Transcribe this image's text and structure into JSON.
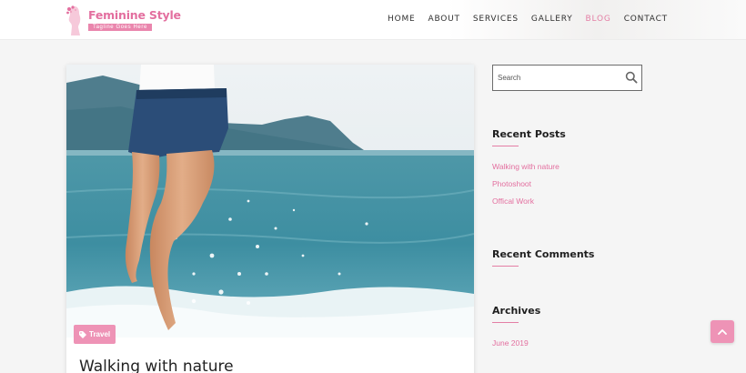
{
  "brand": {
    "title": "Feminine Style",
    "tagline": "Tagline Goes Here"
  },
  "nav": {
    "items": [
      {
        "label": "HOME"
      },
      {
        "label": "ABOUT"
      },
      {
        "label": "SERVICES"
      },
      {
        "label": "GALLERY"
      },
      {
        "label": "BLOG",
        "active": true
      },
      {
        "label": "CONTACT"
      }
    ]
  },
  "post": {
    "image_icon": "beach-photo",
    "tag": "Travel",
    "title": "Walking with nature"
  },
  "sidebar": {
    "search": {
      "placeholder": "Search",
      "value": ""
    },
    "recent_posts": {
      "title": "Recent Posts",
      "items": [
        "Walking with nature",
        "Photoshoot",
        "Offical Work"
      ]
    },
    "recent_comments": {
      "title": "Recent Comments"
    },
    "archives": {
      "title": "Archives",
      "items": [
        "June 2019"
      ]
    }
  },
  "colors": {
    "accent": "#e47fa5",
    "badge": "#ee93b6",
    "text_dark": "#222222"
  },
  "scroll_top_icon": "chevron-up-icon"
}
